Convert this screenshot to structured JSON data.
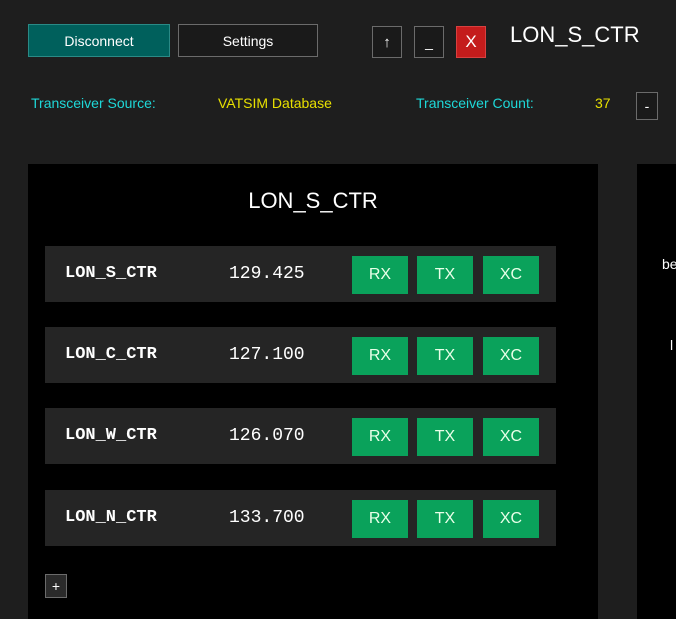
{
  "window": {
    "title": "LON_S_CTR",
    "buttons": {
      "disconnect": "Disconnect",
      "settings": "Settings",
      "up": "↑",
      "minimize": "_",
      "close": "X"
    }
  },
  "info": {
    "source_label": "Transceiver Source:",
    "source_value": "VATSIM Database",
    "count_label": "Transceiver Count:",
    "count_value": "37",
    "collapse_button": "-"
  },
  "panel": {
    "title": "LON_S_CTR",
    "rows": [
      {
        "station": "LON_S_CTR",
        "frequency": "129.425",
        "rx": "RX",
        "tx": "TX",
        "xc": "XC"
      },
      {
        "station": "LON_C_CTR",
        "frequency": "127.100",
        "rx": "RX",
        "tx": "TX",
        "xc": "XC"
      },
      {
        "station": "LON_W_CTR",
        "frequency": "126.070",
        "rx": "RX",
        "tx": "TX",
        "xc": "XC"
      },
      {
        "station": "LON_N_CTR",
        "frequency": "133.700",
        "rx": "RX",
        "tx": "TX",
        "xc": "XC"
      }
    ],
    "add_button": "+"
  },
  "right_panel": {
    "fragment_1": "be",
    "fragment_2": "l"
  },
  "colors": {
    "accent_teal": "#00605c",
    "toggle_green": "#0aa25b",
    "close_red": "#c41c1c",
    "label_cyan": "#1ed8d8",
    "value_yellow": "#e8e000"
  }
}
